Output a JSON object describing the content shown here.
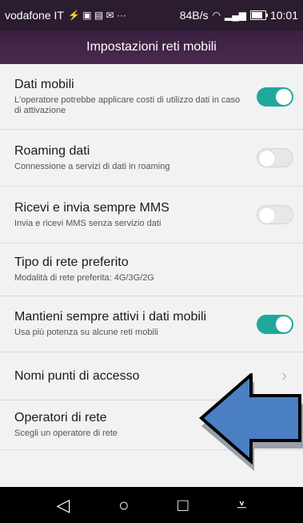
{
  "status_bar": {
    "carrier": "vodafone IT",
    "speed": "84B/s",
    "time": "10:01"
  },
  "header": {
    "title": "Impostazioni reti mobili"
  },
  "settings": [
    {
      "title": "Dati mobili",
      "subtitle": "L'operatore potrebbe applicare costi di utilizzo dati in caso di attivazione",
      "control": "toggle",
      "on": true
    },
    {
      "title": "Roaming dati",
      "subtitle": "Connessione a servizi di dati in roaming",
      "control": "toggle",
      "on": false
    },
    {
      "title": "Ricevi e invia sempre MMS",
      "subtitle": "Invia e ricevi MMS senza servizio dati",
      "control": "toggle",
      "on": false
    },
    {
      "title": "Tipo di rete preferito",
      "subtitle": "Modalità di rete preferita: 4G/3G/2G",
      "control": "none"
    },
    {
      "title": "Mantieni sempre attivi i dati mobili",
      "subtitle": "Usa più potenza su alcune reti mobili",
      "control": "toggle",
      "on": true
    },
    {
      "title": "Nomi punti di accesso",
      "subtitle": "",
      "control": "chevron"
    },
    {
      "title": "Operatori di rete",
      "subtitle": "Scegli un operatore di rete",
      "control": "none"
    }
  ],
  "colors": {
    "toggle_on": "#1fa99c",
    "header_bg": "#3a2040",
    "arrow_fill": "#4a7fc4"
  }
}
